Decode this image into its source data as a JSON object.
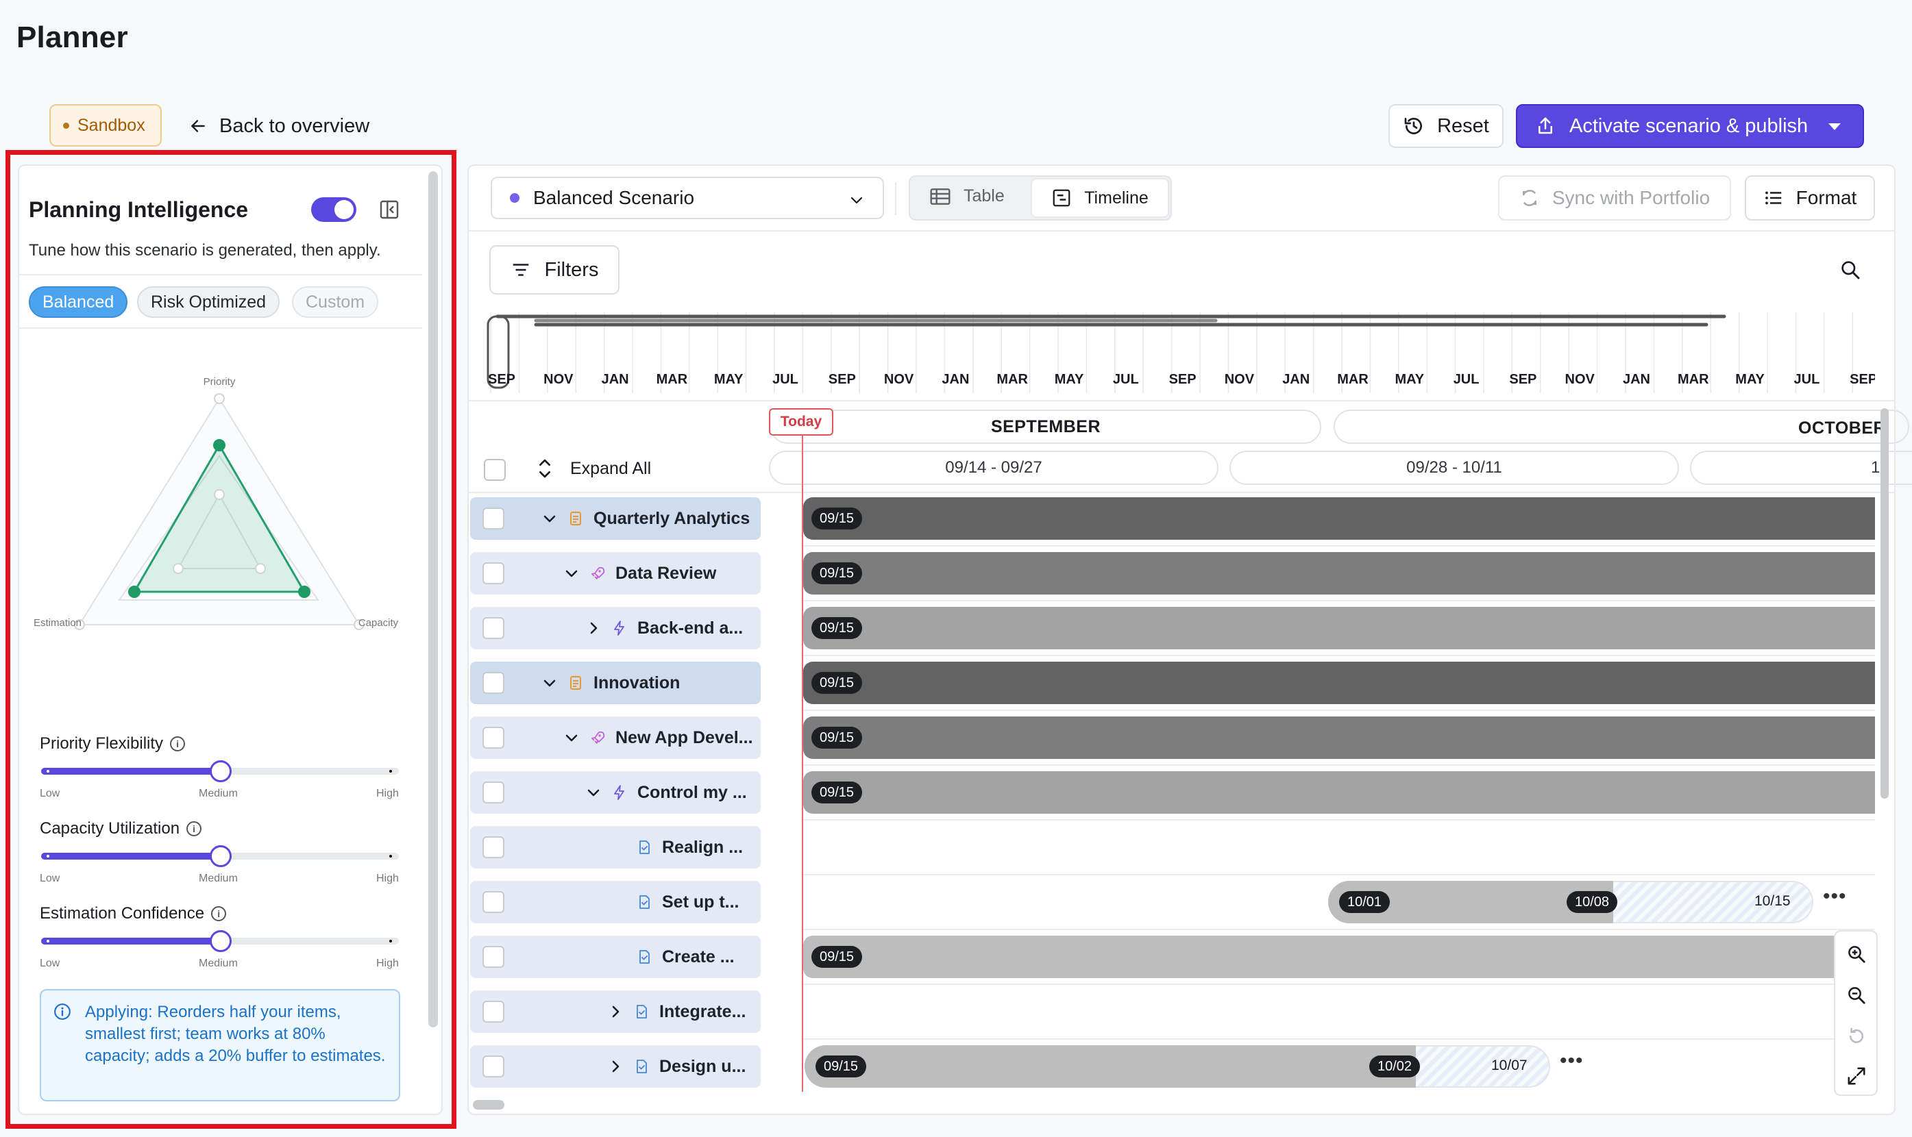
{
  "app": {
    "title": "Planner"
  },
  "header": {
    "badge": "Sandbox",
    "back_label": "Back to overview",
    "reset_label": "Reset",
    "activate_label": "Activate scenario & publish",
    "colors": {
      "accent": "#5a47e0",
      "badge_bg": "#fdf3e4"
    }
  },
  "panel": {
    "title": "Planning Intelligence",
    "toggle_on": true,
    "subtitle": "Tune how this scenario is generated, then apply.",
    "presets": [
      "Balanced",
      "Risk Optimized",
      "Custom"
    ],
    "selected_preset": "Balanced",
    "radar": {
      "priority_label": "Priority",
      "estimation_label": "Estimation",
      "capacity_label": "Capacity"
    },
    "sliders": [
      {
        "label": "Priority Flexibility",
        "value": 0.5,
        "low": "Low",
        "mid": "Medium",
        "high": "High"
      },
      {
        "label": "Capacity Utilization",
        "value": 0.5,
        "low": "Low",
        "mid": "Medium",
        "high": "High"
      },
      {
        "label": "Estimation Confidence",
        "value": 0.5,
        "low": "Low",
        "mid": "Medium",
        "high": "High"
      }
    ],
    "applying_text": "Applying: Reorders half your items, smallest first; team works at 80% capacity; adds a 20% buffer to estimates."
  },
  "toolbar": {
    "scenario": "Balanced Scenario",
    "view_table": "Table",
    "view_timeline": "Timeline",
    "active_view": "Timeline",
    "sync_label": "Sync with Portfolio",
    "format_label": "Format",
    "filters_label": "Filters"
  },
  "overview": {
    "months": [
      "SEP",
      "NOV",
      "JAN",
      "MAR",
      "MAY",
      "JUL",
      "SEP",
      "NOV",
      "JAN",
      "MAR",
      "MAY",
      "JUL",
      "SEP",
      "NOV",
      "JAN",
      "MAR",
      "MAY",
      "JUL",
      "SEP",
      "NOV",
      "JAN",
      "MAR",
      "MAY",
      "JUL",
      "SEP"
    ]
  },
  "timeline": {
    "today_label": "Today",
    "month_1": "SEPTEMBER",
    "month_2": "OCTOBER",
    "weeks": [
      "09/14 - 09/27",
      "09/28 - 10/11",
      "1"
    ],
    "expand_all": "Expand All"
  },
  "rows": [
    {
      "label": "Quarterly Analytics",
      "start": "09/15"
    },
    {
      "label": "Data Review",
      "start": "09/15"
    },
    {
      "label": "Back-end a...",
      "start": "09/15"
    },
    {
      "label": "Innovation",
      "start": "09/15"
    },
    {
      "label": "New App Devel...",
      "start": "09/15"
    },
    {
      "label": "Control my ...",
      "start": "09/15"
    },
    {
      "label": "Realign ..."
    },
    {
      "label": "Set up t...",
      "start": "10/01",
      "mid": "10/08",
      "end": "10/15"
    },
    {
      "label": "Create ...",
      "start": "09/15"
    },
    {
      "label": "Integrate..."
    },
    {
      "label": "Design u...",
      "start": "09/15",
      "mid": "10/02",
      "end": "10/07"
    }
  ]
}
